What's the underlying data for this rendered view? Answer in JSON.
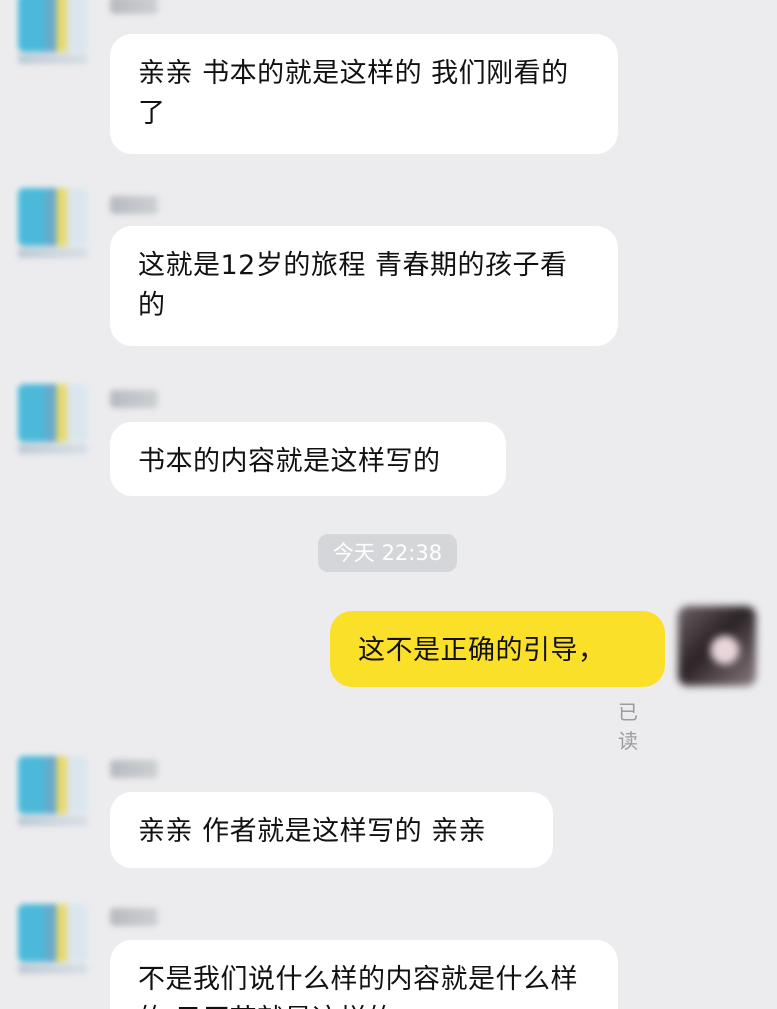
{
  "messages": [
    {
      "sender": "merchant",
      "text": "亲亲 书本的就是这样的 我们刚看的了"
    },
    {
      "sender": "merchant",
      "text": "这就是12岁的旅程 青春期的孩子看的"
    },
    {
      "sender": "merchant",
      "text": "书本的内容就是这样写的"
    },
    {
      "sender": "user",
      "text": "这不是正确的引导，",
      "status": "已读"
    },
    {
      "sender": "merchant",
      "text": "亲亲 作者就是这样写的 亲亲"
    },
    {
      "sender": "merchant",
      "text": "不是我们说什么样的内容就是什么样的 只厂节就是这样的"
    }
  ],
  "timestamp": "今天 22:38",
  "colors": {
    "background": "#ececee",
    "merchant_bubble": "#ffffff",
    "user_bubble": "#fbe02a",
    "timestamp_pill": "#d4d6d9"
  },
  "icons": {
    "merchant_avatar": "blurred-store-avatar",
    "user_avatar": "blurred-user-avatar"
  }
}
